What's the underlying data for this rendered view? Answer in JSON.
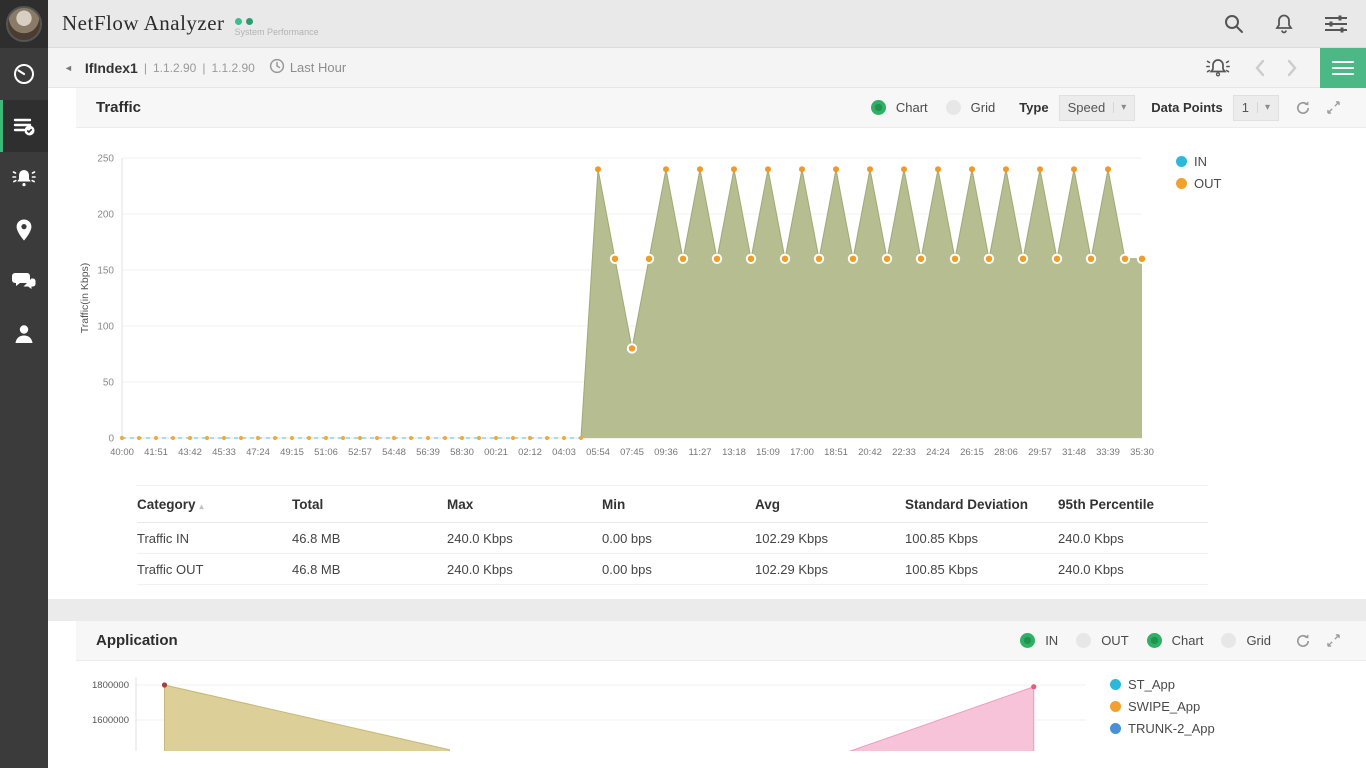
{
  "app": {
    "title": "NetFlow Analyzer",
    "caption": "System Performance"
  },
  "icons": {
    "topbar": [
      "search-icon",
      "bell-icon",
      "sliders-icon"
    ],
    "sidebar": [
      "gauge-icon",
      "list-check-icon",
      "bell-ring-icon",
      "map-pin-icon",
      "chat-icon",
      "person-icon"
    ],
    "subheader": [
      "back-icon",
      "clock-icon",
      "alarm-bell-icon",
      "chevron-left-icon",
      "chevron-right-icon",
      "menu-icon"
    ],
    "panel": [
      "refresh-icon",
      "expand-icon"
    ]
  },
  "colors": {
    "accent_green": "#2fb064",
    "button_green": "#4cb885",
    "area_fill": "#b6bd90",
    "marker_orange": "#ef9d28",
    "legend_in": "#2bb8d9",
    "legend_out": "#f0a12f"
  },
  "subheader": {
    "back": "◄",
    "title": "IfIndex1",
    "sep": "|",
    "ip1": "1.1.2.90",
    "ip2": "1.1.2.90",
    "time_range": "Last Hour"
  },
  "traffic_panel": {
    "title": "Traffic",
    "chart_label": "Chart",
    "grid_label": "Grid",
    "type_label": "Type",
    "type_value": "Speed",
    "caret": "▾",
    "datapoints_label": "Data Points",
    "datapoints_value": "1"
  },
  "traffic_table": {
    "headers": [
      "Category",
      "Total",
      "Max",
      "Min",
      "Avg",
      "Standard Deviation",
      "95th Percentile"
    ],
    "sort_indicator": "▴",
    "rows": [
      [
        "Traffic IN",
        "46.8 MB",
        "240.0 Kbps",
        "0.00 bps",
        "102.29 Kbps",
        "100.85 Kbps",
        "240.0 Kbps"
      ],
      [
        "Traffic OUT",
        "46.8 MB",
        "240.0 Kbps",
        "0.00 bps",
        "102.29 Kbps",
        "100.85 Kbps",
        "240.0 Kbps"
      ]
    ]
  },
  "application_panel": {
    "title": "Application",
    "in_label": "IN",
    "out_label": "OUT",
    "chart_label": "Chart",
    "grid_label": "Grid"
  },
  "chart_data": [
    {
      "type": "area",
      "title": "Traffic",
      "ylabel": "Traffic(in Kbps)",
      "ylim": [
        0,
        250
      ],
      "yticks": [
        0,
        50,
        100,
        150,
        200,
        250
      ],
      "grid": true,
      "legend_position": "right",
      "x_labels": [
        "40:00",
        "41:51",
        "43:42",
        "45:33",
        "47:24",
        "49:15",
        "51:06",
        "52:57",
        "54:48",
        "56:39",
        "58:30",
        "00:21",
        "02:12",
        "04:03",
        "05:54",
        "07:45",
        "09:36",
        "11:27",
        "13:18",
        "15:09",
        "17:00",
        "18:51",
        "20:42",
        "22:33",
        "24:24",
        "26:15",
        "28:06",
        "29:57",
        "31:48",
        "33:39",
        "35:30"
      ],
      "series": [
        {
          "name": "IN",
          "color": "#2bb8d9",
          "style": "dashed-line-under-area",
          "points": [
            [
              0,
              0
            ],
            [
              13.5,
              0
            ]
          ]
        },
        {
          "name": "OUT",
          "color": "#f0a12f",
          "fill": "#b6bd90",
          "stroke": "#a0aa74",
          "points": [
            [
              0,
              0
            ],
            [
              0.5,
              0
            ],
            [
              1,
              0
            ],
            [
              1.5,
              0
            ],
            [
              2,
              0
            ],
            [
              2.5,
              0
            ],
            [
              3,
              0
            ],
            [
              3.5,
              0
            ],
            [
              4,
              0
            ],
            [
              4.5,
              0
            ],
            [
              5,
              0
            ],
            [
              5.5,
              0
            ],
            [
              6,
              0
            ],
            [
              6.5,
              0
            ],
            [
              7,
              0
            ],
            [
              7.5,
              0
            ],
            [
              8,
              0
            ],
            [
              8.5,
              0
            ],
            [
              9,
              0
            ],
            [
              9.5,
              0
            ],
            [
              10,
              0
            ],
            [
              10.5,
              0
            ],
            [
              11,
              0
            ],
            [
              11.5,
              0
            ],
            [
              12,
              0
            ],
            [
              12.5,
              0
            ],
            [
              13,
              0
            ],
            [
              13.5,
              0
            ],
            [
              14,
              240
            ],
            [
              14.5,
              160
            ],
            [
              15,
              80
            ],
            [
              15.5,
              160
            ],
            [
              16,
              240
            ],
            [
              16.5,
              160
            ],
            [
              17,
              240
            ],
            [
              17.5,
              160
            ],
            [
              18,
              240
            ],
            [
              18.5,
              160
            ],
            [
              19,
              240
            ],
            [
              19.5,
              160
            ],
            [
              20,
              240
            ],
            [
              20.5,
              160
            ],
            [
              21,
              240
            ],
            [
              21.5,
              160
            ],
            [
              22,
              240
            ],
            [
              22.5,
              160
            ],
            [
              23,
              240
            ],
            [
              23.5,
              160
            ],
            [
              24,
              240
            ],
            [
              24.5,
              160
            ],
            [
              25,
              240
            ],
            [
              25.5,
              160
            ],
            [
              26,
              240
            ],
            [
              26.5,
              160
            ],
            [
              27,
              240
            ],
            [
              27.5,
              160
            ],
            [
              28,
              240
            ],
            [
              28.5,
              160
            ],
            [
              29,
              240
            ],
            [
              29.5,
              160
            ],
            [
              30,
              160
            ]
          ]
        }
      ]
    },
    {
      "type": "area",
      "title": "Application",
      "yticks": [
        1800000,
        1600000
      ],
      "grid": true,
      "legend_position": "right",
      "legend": [
        {
          "name": "ST_App",
          "color": "#2bb8d9"
        },
        {
          "name": "SWIPE_App",
          "color": "#f0a12f"
        },
        {
          "name": "TRUNK-2_App",
          "color": "#4a90d9"
        }
      ],
      "visible_series": [
        {
          "name": "declining-area",
          "fill": "#dccf97",
          "stroke": "#c8b878",
          "marker_color": "#a8403a",
          "points": [
            [
              0.03,
              1800000
            ],
            [
              0.33,
              1430000
            ]
          ]
        },
        {
          "name": "rising-area",
          "fill": "#f7c3d8",
          "stroke": "#ee9abd",
          "marker_color": "#e0607e",
          "points": [
            [
              0.74,
              1400000
            ],
            [
              0.945,
              1790000
            ]
          ]
        }
      ]
    }
  ]
}
